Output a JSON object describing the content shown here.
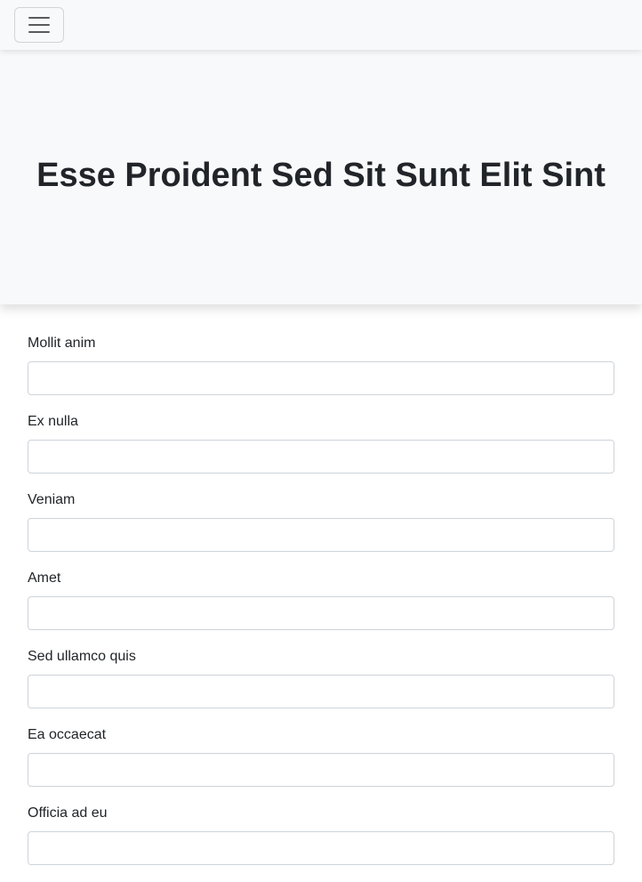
{
  "navbar": {
    "toggler_icon": "hamburger-menu-icon"
  },
  "hero": {
    "title": "Esse Proident Sed Sit Sunt Elit Sint"
  },
  "form": {
    "fields": [
      {
        "label": "Mollit anim",
        "value": ""
      },
      {
        "label": "Ex nulla",
        "value": ""
      },
      {
        "label": "Veniam",
        "value": ""
      },
      {
        "label": "Amet",
        "value": ""
      },
      {
        "label": "Sed ullamco quis",
        "value": ""
      },
      {
        "label": "Ea occaecat",
        "value": ""
      },
      {
        "label": "Officia ad eu",
        "value": ""
      }
    ]
  }
}
